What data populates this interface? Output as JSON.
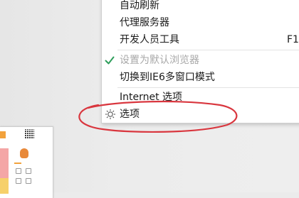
{
  "menu": {
    "items": [
      {
        "label": "自动刷新",
        "enabled": true
      },
      {
        "label": "代理服务器",
        "enabled": true
      },
      {
        "label": "开发人员工具",
        "shortcut": "F1",
        "enabled": true
      },
      {
        "label": "设置为默认浏览器",
        "enabled": false,
        "checked": true,
        "icon": "checkmark-icon"
      },
      {
        "label": "切换到IE6多窗口模式",
        "enabled": true
      },
      {
        "label": "Internet 选项",
        "enabled": true
      },
      {
        "label": "选项",
        "enabled": true,
        "icon": "gear-icon"
      }
    ]
  },
  "colors": {
    "annotation": "#d9363e",
    "check": "#2e9e5b",
    "disabled_text": "#a8a8a8",
    "text": "#1a1a1a"
  }
}
